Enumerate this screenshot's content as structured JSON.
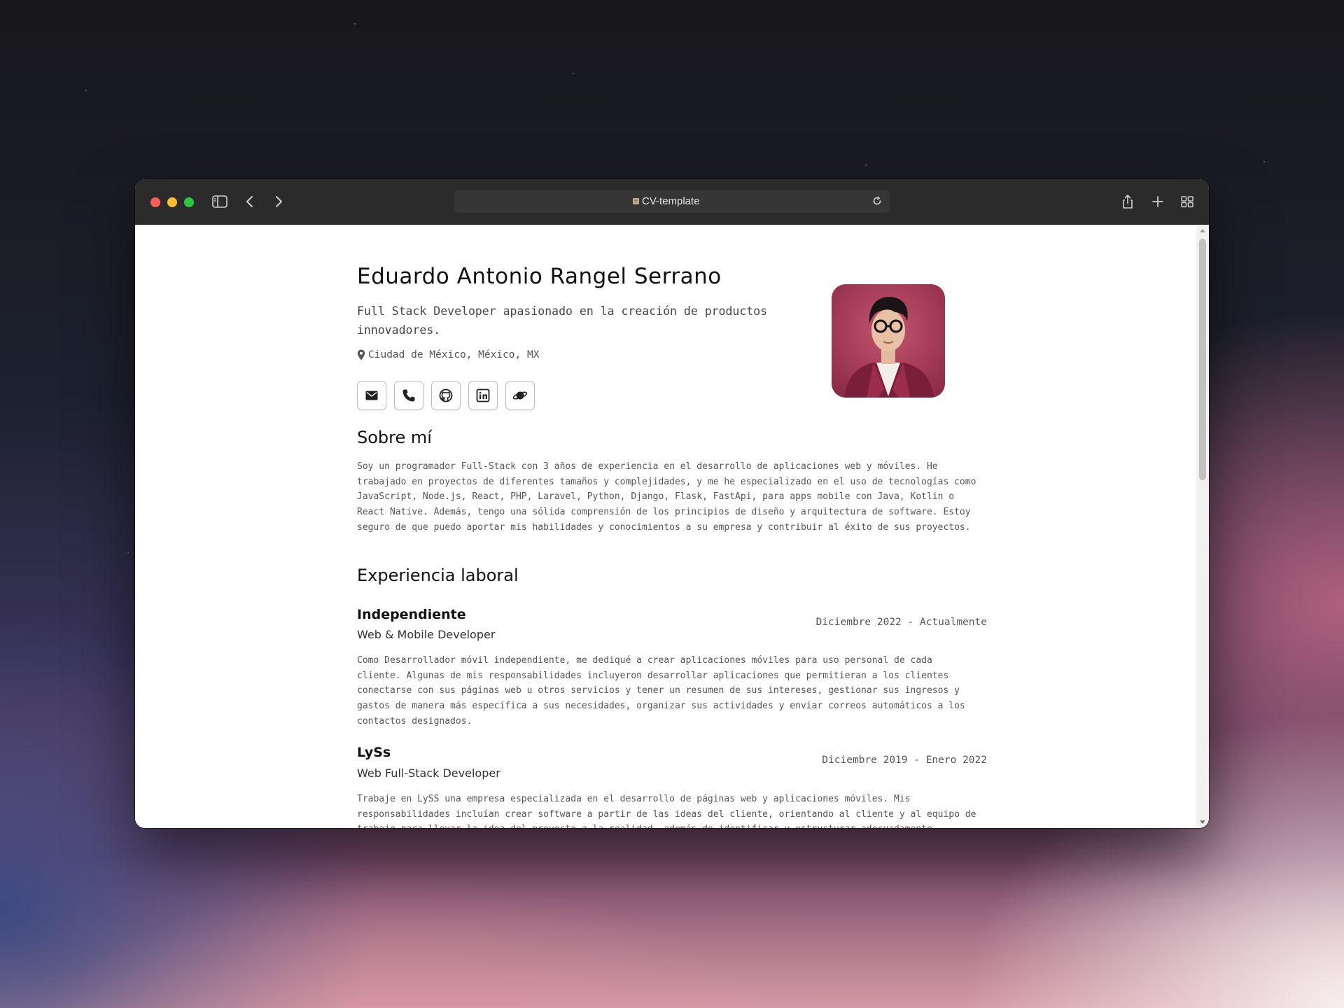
{
  "browser": {
    "address_text": "CV-template"
  },
  "cv": {
    "name": "Eduardo Antonio Rangel Serrano",
    "tagline": "Full Stack Developer apasionado en la creación de productos innovadores.",
    "location": "Ciudad de México, México, MX",
    "socials": [
      {
        "icon": "email-icon"
      },
      {
        "icon": "phone-icon"
      },
      {
        "icon": "github-icon"
      },
      {
        "icon": "linkedin-icon"
      },
      {
        "icon": "planet-icon"
      }
    ],
    "about_title": "Sobre mí",
    "about_text": "Soy un programador Full-Stack con 3 años de experiencia en el desarrollo de aplicaciones web y móviles. He trabajado en proyectos de diferentes tamaños y complejidades, y me he especializado en el uso de tecnologías como JavaScript, Node.js, React, PHP, Laravel, Python, Django, Flask, FastApi, para apps mobile con Java, Kotlin o React Native. Además, tengo una sólida comprensión de los principios de diseño y arquitectura de software. Estoy seguro de que puedo aportar mis habilidades y conocimientos a su empresa y contribuir al éxito de sus proyectos.",
    "experience_title": "Experiencia laboral",
    "jobs": [
      {
        "company": "Independiente",
        "role": "Web & Mobile Developer",
        "dates": "Diciembre 2022 - Actualmente",
        "description": "Como Desarrollador móvil independiente, me dediqué a crear aplicaciones móviles para uso personal de cada cliente. Algunas de mis responsabilidades incluyeron desarrollar aplicaciones que permitieran a los clientes conectarse con sus páginas web u otros servicios y tener un resumen de sus intereses, gestionar sus ingresos y gastos de manera más específica a sus necesidades, organizar sus actividades y enviar correos automáticos a los contactos designados."
      },
      {
        "company": "LySs",
        "role": "Web Full-Stack Developer",
        "dates": "Diciembre 2019 - Enero 2022",
        "description": "Trabaje en LySS una empresa especializada en el desarrollo de páginas web y aplicaciones móviles. Mis responsabilidades incluían crear software a partir de las ideas del cliente, orientando al cliente y al equipo de trabajo para llevar la idea del proyecto a la realidad, además de identificar y estructurar adecuadamente"
      }
    ]
  },
  "colors": {
    "toolbar": "#2b2b2b",
    "close": "#fe5f57",
    "minimize": "#febc2e",
    "zoom": "#28c840",
    "avatar_bg": "#b13b60"
  }
}
